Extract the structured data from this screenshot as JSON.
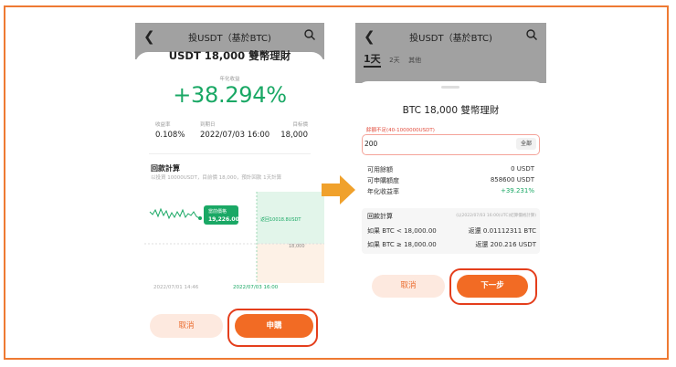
{
  "left": {
    "header_title": "投USDT（基於BTC)",
    "product_title": "USDT 18,000 雙幣理財",
    "rate_label": "年化收益",
    "rate_value": "+38.294%",
    "stats": [
      {
        "label": "收益率",
        "value": "0.108%"
      },
      {
        "label": "到期日",
        "value": "2022/07/03 16:00"
      },
      {
        "label": "目标價",
        "value": "18,000"
      }
    ],
    "section_title": "回款計算",
    "section_note": "以投資 10000USDT，目前價 18,000，預計回款 1天計算",
    "chart": {
      "tooltip_label": "當前價格",
      "tooltip_value": "19,226.00",
      "zone_label": "返回10018.8USDT",
      "target_label": "18,000",
      "start_date": "2022/07/01 14:46",
      "end_date": "2022/07/03 16:00"
    },
    "cancel_label": "取消",
    "confirm_label": "申購"
  },
  "right": {
    "header_title": "投USDT（基於BTC)",
    "tabs": [
      "1天",
      "2天",
      "其他"
    ],
    "product_title": "BTC 18,000 雙幣理財",
    "amount_error": "餘額不足(40-1000000USDT)",
    "amount_value": "200",
    "all_label": "全部",
    "rows": [
      {
        "label": "可用餘額",
        "value": "0 USDT"
      },
      {
        "label": "可申購額度",
        "value": "858600 USDT"
      },
      {
        "label": "年化收益率",
        "value": "+39.231%"
      }
    ],
    "calc_title": "回款計算",
    "calc_note": "(以2022/07/03 16:00(UTC)結算價格計算)",
    "calc_rows": [
      {
        "label": "如果 BTC < 18,000.00",
        "value": "返還 0.01112311 BTC"
      },
      {
        "label": "如果 BTC ≥ 18,000.00",
        "value": "返還 200.216 USDT"
      }
    ],
    "cancel_label": "取消",
    "next_label": "下一步"
  },
  "colors": {
    "frame": "#ee7a33",
    "accent_orange": "#f26b24",
    "green": "#1aa865",
    "highlight_red": "#e43e1c",
    "arrow": "#f0a12c"
  }
}
